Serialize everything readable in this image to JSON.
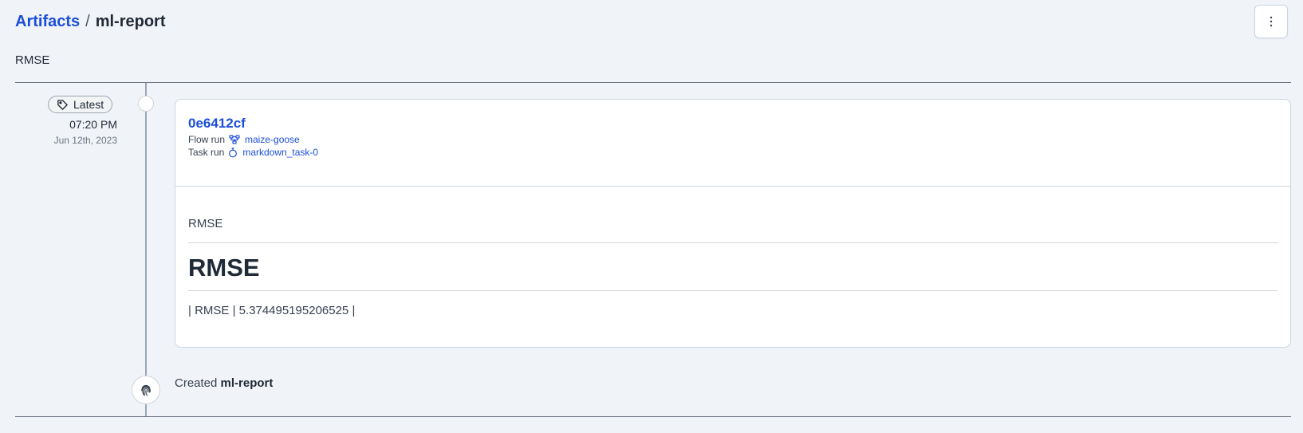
{
  "breadcrumb": {
    "root": "Artifacts",
    "separator": "/",
    "current": "ml-report"
  },
  "subtitle": "RMSE",
  "timeline": {
    "badge": "Latest",
    "time": "07:20 PM",
    "date": "Jun 12th, 2023"
  },
  "card": {
    "id": "0e6412cf",
    "flow_run_label": "Flow run",
    "flow_run_value": "maize-goose",
    "task_run_label": "Task run",
    "task_run_value": "markdown_task-0",
    "markdown": {
      "paragraph": "RMSE",
      "heading": "RMSE",
      "table_row": "| RMSE | 5.374495195206525 |"
    }
  },
  "created": {
    "prefix": "Created",
    "name": "ml-report"
  },
  "colors": {
    "accent": "#1d4ed8",
    "background": "#f0f4f8",
    "timeline": "#9aa5b8"
  }
}
